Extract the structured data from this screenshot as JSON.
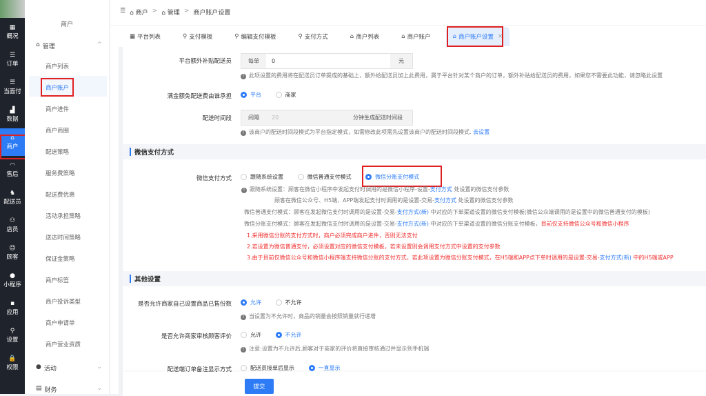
{
  "rail": [
    {
      "icon": "grid",
      "label": "概况"
    },
    {
      "icon": "list",
      "label": "订单"
    },
    {
      "icon": "list",
      "label": "当面付"
    },
    {
      "icon": "bar-chart",
      "label": "数据"
    },
    {
      "icon": "store",
      "label": "商户"
    },
    {
      "icon": "headset",
      "label": "售后"
    },
    {
      "icon": "rider",
      "label": "配送员"
    },
    {
      "icon": "users",
      "label": "店员"
    },
    {
      "icon": "customer",
      "label": "顾客"
    },
    {
      "icon": "wechat",
      "label": "小程序"
    },
    {
      "icon": "apps",
      "label": "应用"
    },
    {
      "icon": "user-gear",
      "label": "设置"
    },
    {
      "icon": "lock",
      "label": "权限"
    }
  ],
  "sub": {
    "title": "商户",
    "group": "管理",
    "items": [
      "商户列表",
      "商户账户",
      "商户进件",
      "商户商圈",
      "配送策略",
      "服务费策略",
      "配送费优惠",
      "活动承担策略",
      "送达时间策略",
      "保证金策略",
      "商户标签",
      "商户投诉类型",
      "商户申请单",
      "商户营业资质"
    ],
    "groups_collapsed": [
      "活动",
      "财务"
    ]
  },
  "breadcrumb": [
    "商户",
    "管理",
    "商户账户设置"
  ],
  "tabs": [
    "平台列表",
    "支付模板",
    "编辑支付模板",
    "支付方式",
    "商户列表",
    "商户账户",
    "商户账户设置"
  ],
  "form": {
    "subsidy": {
      "label": "平台额外补贴配送员",
      "prefix": "每单",
      "value": "0",
      "suffix": "元",
      "note": "此项设置的费用将在配送员订单提成的基础上，额外给配送员加上此费用，属于平台针对某个商户的订单，额外补贴给配送员的费用，如果您不需要此功能，请忽略此设置"
    },
    "free_bearer": {
      "label": "满金额免配送费由谁承担",
      "options": [
        "平台",
        "商家"
      ],
      "selected": "平台"
    },
    "period": {
      "label": "配送时间段",
      "prefix": "间隔",
      "value": "20",
      "suffix": "分钟生成配送时间段",
      "note": "该商户的配送时间段模式为平台指定模式，如需修改此项需先设置该商户的配送时间段模式.",
      "link": "去设置"
    }
  },
  "wechat": {
    "section": "微信支付方式",
    "label": "微信支付方式",
    "options": [
      "跟随系统设置",
      "微信普通支付模式",
      "微信分账支付模式"
    ],
    "selected": "微信分账支付模式",
    "help": [
      {
        "pre": "跟随系统设置：顾客在微信小程序中发起支付时调用的是微信小程序-设置-",
        "link": "支付方式",
        "post": "处设置的微信支付参数"
      },
      {
        "pre": "顾客在微信公众号、H5端、APP端发起支付时调用的是设置-交易-",
        "link": "支付方式",
        "post": "处设置的微信支付参数"
      },
      {
        "pre": "微信普通支付模式：顾客在发起微信支付时调用的是设置-交易-",
        "link": "支付方式(新)",
        "post": "中对应的下单渠道设置的微信支付模板(微信公众端调用的是设置中的微信普通支付的模板)"
      },
      {
        "pre": "微信分账支付模式：顾客在发起微信支付时调用的是设置-交易-",
        "link": "支付方式(新)",
        "post": "中对应的下单渠道设置的微信分账支付模板，",
        "red": "目前仅支持微信公众号和微信小程序"
      }
    ],
    "warnings": [
      "1.采用微信分账的支付方式时，商户必须完成商户进件，否则无法支付",
      "2.若设置为微信普通支付，必须设置对应的微信支付模板，若未设置则会调用支付方式中设置的支付参数"
    ],
    "warning3": {
      "pre": "3.由于目前仅微信公众号和微信小程序端支持微信分账的支付方式，若此项设置为微信分账支付模式，在H5端和APP点下单时调用的是设置-交易-",
      "link": "支付方式(新)",
      "post": "中的H5端或APP"
    }
  },
  "other": {
    "section": "其他设置",
    "sold": {
      "label": "是否允许商家自己设置商品已售份数",
      "options": [
        "允许",
        "不允许"
      ],
      "selected": "允许",
      "note": "当设置为不允许时，商品的销量会按照销量就行递增"
    },
    "review": {
      "label": "是否允许商家审核顾客评价",
      "options": [
        "允许",
        "不允许"
      ],
      "selected": "不允许",
      "note": "注意:设置为不允许后,顾客对于商家的评价将直接审核通过并显示到手机端"
    },
    "remark": {
      "label": "配送端订单备注显示方式",
      "options": [
        "配送员接单后显示",
        "一直显示"
      ],
      "selected": "一直显示"
    }
  },
  "submit": "提交",
  "colors": {
    "accent": "#2d7cf6",
    "rail": "#1f232b",
    "warning": "#f03030",
    "highlight": "#e02020"
  }
}
